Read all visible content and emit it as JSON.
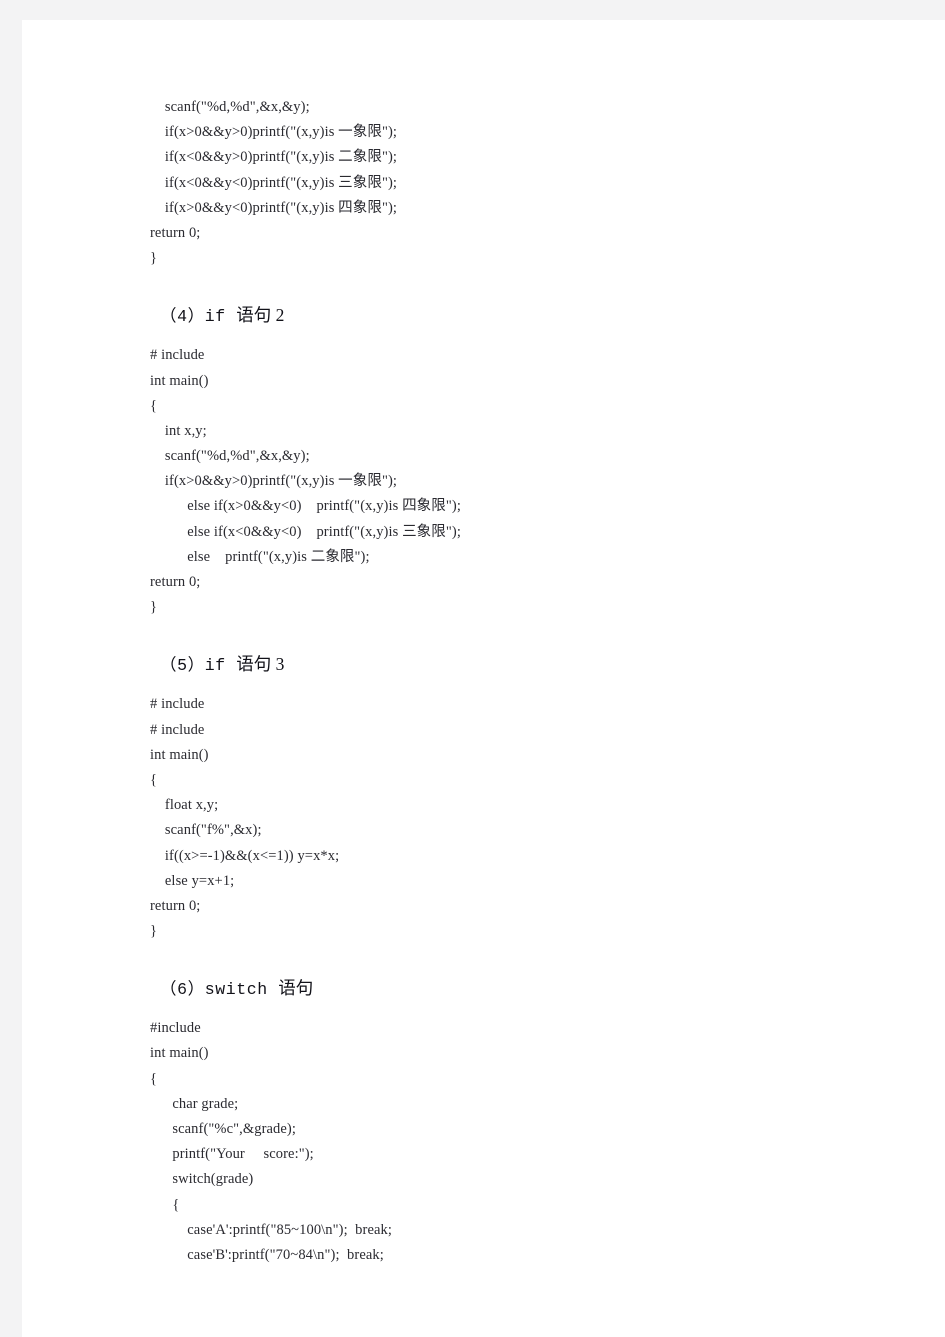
{
  "document": {
    "page_background": "#ffffff",
    "gutter_color": "#f3f3f4",
    "text_color": "#2a2a30"
  },
  "blocks": [
    {
      "type": "code",
      "name": "code-block-if-statement-1-tail",
      "lines": [
        "    scanf(\"%d,%d\",&x,&y);",
        "    if(x>0&&y>0)printf(\"(x,y)is 一象限\");",
        "    if(x<0&&y>0)printf(\"(x,y)is 二象限\");",
        "    if(x<0&&y<0)printf(\"(x,y)is 三象限\");",
        "    if(x>0&&y<0)printf(\"(x,y)is 四象限\");",
        "return 0;",
        "}"
      ]
    },
    {
      "type": "heading",
      "name": "heading-if-statement-2",
      "mono": "（4）if ",
      "cjk": "语句 2"
    },
    {
      "type": "code",
      "name": "code-block-if-statement-2",
      "lines": [
        "# include",
        "int main()",
        "{",
        "    int x,y;",
        "    scanf(\"%d,%d\",&x,&y);",
        "    if(x>0&&y>0)printf(\"(x,y)is 一象限\");",
        "          else if(x>0&&y<0)    printf(\"(x,y)is 四象限\");",
        "          else if(x<0&&y<0)    printf(\"(x,y)is 三象限\");",
        "          else    printf(\"(x,y)is 二象限\");",
        "return 0;",
        "}"
      ]
    },
    {
      "type": "heading",
      "name": "heading-if-statement-3",
      "mono": "（5）if ",
      "cjk": "语句 3"
    },
    {
      "type": "code",
      "name": "code-block-if-statement-3",
      "lines": [
        "# include",
        "# include",
        "int main()",
        "{",
        "    float x,y;",
        "    scanf(\"f%\",&x);",
        "    if((x>=-1)&&(x<=1)) y=x*x;",
        "    else y=x+1;",
        "return 0;",
        "}"
      ]
    },
    {
      "type": "heading",
      "name": "heading-switch-statement",
      "mono": "（6）switch ",
      "cjk": "语句"
    },
    {
      "type": "code",
      "name": "code-block-switch-statement",
      "lines": [
        "#include",
        "int main()",
        "{",
        "      char grade;",
        "      scanf(\"%c\",&grade);",
        "      printf(\"Your     score:\");",
        "      switch(grade)",
        "      {",
        "          case'A':printf(\"85~100\\n\");  break;",
        "          case'B':printf(\"70~84\\n\");  break;"
      ]
    }
  ]
}
